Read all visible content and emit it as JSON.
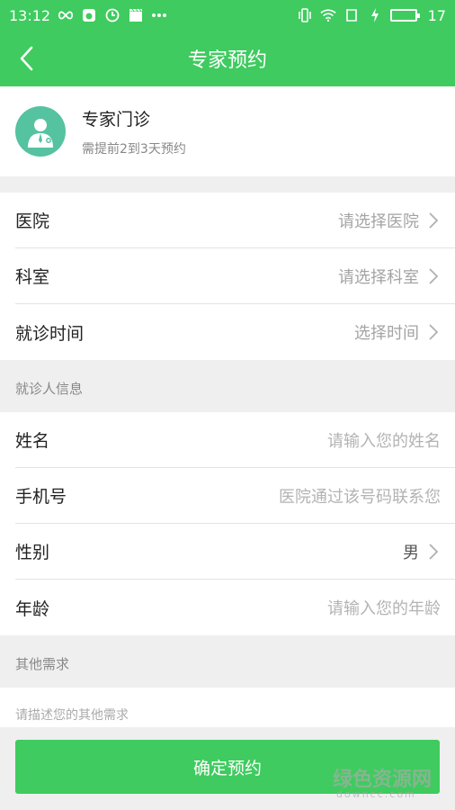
{
  "status_bar": {
    "time": "13:12",
    "battery": "17"
  },
  "nav": {
    "title": "专家预约"
  },
  "expert": {
    "title": "专家门诊",
    "subtitle": "需提前2到3天预约"
  },
  "appointment": {
    "hospital_label": "医院",
    "hospital_value": "请选择医院",
    "department_label": "科室",
    "department_value": "请选择科室",
    "time_label": "就诊时间",
    "time_value": "选择时间"
  },
  "patient_section": {
    "title": "就诊人信息"
  },
  "patient": {
    "name_label": "姓名",
    "name_placeholder": "请输入您的姓名",
    "phone_label": "手机号",
    "phone_placeholder": "医院通过该号码联系您",
    "gender_label": "性别",
    "gender_value": "男",
    "age_label": "年龄",
    "age_placeholder": "请输入您的年龄"
  },
  "other_section": {
    "title": "其他需求",
    "placeholder": "请描述您的其他需求"
  },
  "submit": {
    "label": "确定预约"
  },
  "watermark": {
    "main": "绿色资源网",
    "sub": "downcc.com"
  },
  "colors": {
    "primary": "#3fcb5f",
    "avatar": "#55c2a0"
  }
}
